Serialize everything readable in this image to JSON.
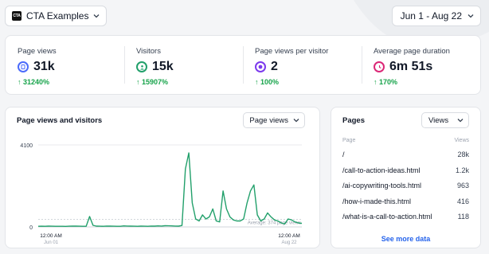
{
  "header": {
    "site_name": "CTA Examples",
    "site_logo_text": "CTA",
    "date_range": "Jun 1 - Aug 22"
  },
  "stats": [
    {
      "label": "Page views",
      "value": "31k",
      "change": "↑ 31240%",
      "icon": "page-views-icon",
      "color": "#4b6bfb"
    },
    {
      "label": "Visitors",
      "value": "15k",
      "change": "↑ 15907%",
      "icon": "visitors-icon",
      "color": "#22a06b"
    },
    {
      "label": "Page views per visitor",
      "value": "2",
      "change": "↑ 100%",
      "icon": "views-per-visitor-icon",
      "color": "#7c3aed"
    },
    {
      "label": "Average page duration",
      "value": "6m 51s",
      "change": "↑ 170%",
      "icon": "duration-icon",
      "color": "#db2777"
    }
  ],
  "chart": {
    "title": "Page views and visitors",
    "metric_select": "Page views"
  },
  "chart_data": {
    "type": "line",
    "series": [
      {
        "values": [
          5,
          5,
          5,
          5,
          5,
          5,
          5,
          5,
          5,
          5,
          5,
          6,
          5,
          5,
          5,
          5,
          5,
          5,
          5,
          6,
          7,
          8,
          9,
          10,
          9,
          8,
          7,
          6,
          5,
          5,
          5,
          5,
          5,
          5,
          5,
          5,
          5,
          5,
          6,
          5,
          5,
          5,
          5,
          5,
          5,
          5,
          5,
          5,
          5,
          5,
          5,
          5,
          5,
          5,
          5,
          5,
          5,
          5,
          5,
          6,
          5,
          5,
          5,
          5,
          5,
          5,
          5,
          5,
          5,
          5,
          5,
          5,
          5,
          5,
          5,
          5,
          5,
          5,
          5,
          5,
          5,
          5,
          5
        ]
      }
    ],
    "x": [
      "12:00 AM Jun 01",
      "12:00 AM Aug 22"
    ],
    "y_ticks": [
      "0",
      "4100"
    ],
    "ylim": [
      0,
      4100
    ],
    "average_label": "Average: 374 page views",
    "color": "#22a06b",
    "x_labels": [
      {
        "time": "12:00 AM",
        "date": "Jun 01"
      },
      {
        "time": "12:00 AM",
        "date": "Aug 22"
      }
    ],
    "points": [
      30,
      35,
      30,
      40,
      35,
      30,
      32,
      30,
      28,
      35,
      40,
      38,
      35,
      30,
      30,
      520,
      80,
      40,
      35,
      30,
      45,
      40,
      35,
      30,
      30,
      50,
      45,
      40,
      35,
      30,
      40,
      35,
      30,
      45,
      40,
      50,
      45,
      60,
      55,
      50,
      45,
      40,
      70,
      2900,
      3700,
      1200,
      400,
      300,
      600,
      400,
      500,
      900,
      300,
      250,
      1800,
      900,
      500,
      350,
      300,
      300,
      400,
      1200,
      1800,
      2100,
      600,
      300,
      400,
      700,
      500,
      350,
      300,
      200,
      150,
      400,
      350,
      250,
      200,
      180
    ]
  },
  "pages": {
    "title": "Pages",
    "select": "Views",
    "col_page": "Page",
    "col_views": "Views",
    "rows": [
      {
        "page": "/",
        "views": "28k"
      },
      {
        "page": "/call-to-action-ideas.html",
        "views": "1.2k"
      },
      {
        "page": "/ai-copywriting-tools.html",
        "views": "963"
      },
      {
        "page": "/how-i-made-this.html",
        "views": "416"
      },
      {
        "page": "/what-is-a-call-to-action.html",
        "views": "118"
      }
    ],
    "see_more": "See more data"
  }
}
